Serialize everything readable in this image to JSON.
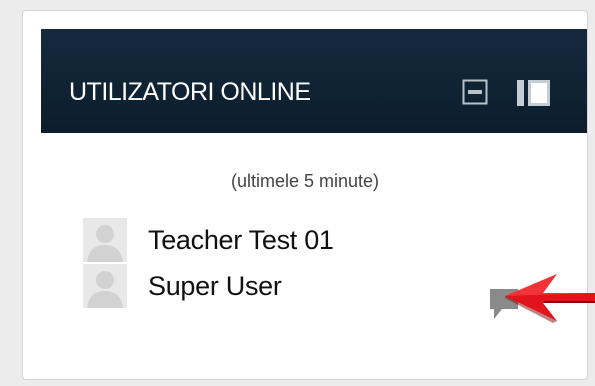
{
  "block": {
    "title": "UTILIZATORI ONLINE",
    "subtitle": "(ultimele 5 minute)",
    "header_icons": [
      "hide-block-icon",
      "dock-block-icon"
    ],
    "users": [
      {
        "name": "Teacher Test 01",
        "avatar": "default-user-avatar"
      },
      {
        "name": "Super User",
        "avatar": "default-user-avatar",
        "message_icon": "message-icon"
      }
    ],
    "colors": {
      "header_bg": "#0f2233",
      "header_text": "#ffffff",
      "arrow": "#e0141a"
    }
  }
}
